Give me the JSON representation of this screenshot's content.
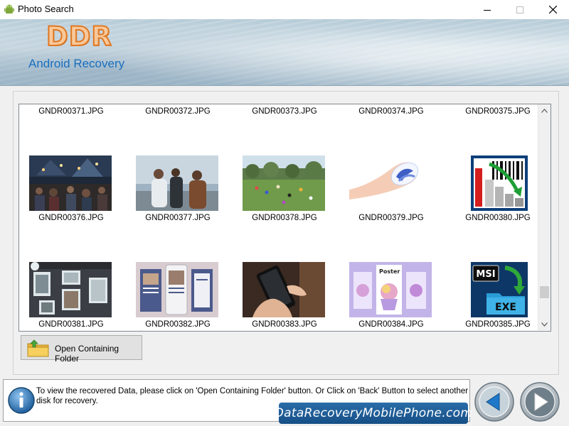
{
  "window": {
    "title": "Photo Search"
  },
  "banner": {
    "logo": "DDR",
    "product": "Android Recovery"
  },
  "grid": {
    "rows": [
      {
        "cells": [
          {
            "label": "GNDR00371.JPG",
            "kind": "none"
          },
          {
            "label": "GNDR00372.JPG",
            "kind": "none"
          },
          {
            "label": "GNDR00373.JPG",
            "kind": "none"
          },
          {
            "label": "GNDR00374.JPG",
            "kind": "none"
          },
          {
            "label": "GNDR00375.JPG",
            "kind": "none"
          }
        ]
      },
      {
        "cells": [
          {
            "label": "GNDR00376.JPG",
            "kind": "night-market"
          },
          {
            "label": "GNDR00377.JPG",
            "kind": "people-talking"
          },
          {
            "label": "GNDR00378.JPG",
            "kind": "park-lawn"
          },
          {
            "label": "GNDR00379.JPG",
            "kind": "nail-art"
          },
          {
            "label": "GNDR00380.JPG",
            "kind": "barcode-chart"
          }
        ]
      },
      {
        "cells": [
          {
            "label": "GNDR00381.JPG",
            "kind": "photo-collage"
          },
          {
            "label": "GNDR00382.JPG",
            "kind": "phone-mockups"
          },
          {
            "label": "GNDR00383.JPG",
            "kind": "hand-phone"
          },
          {
            "label": "GNDR00384.JPG",
            "kind": "poster-designs",
            "text": "Poster"
          },
          {
            "label": "GNDR00385.JPG",
            "kind": "msi-exe",
            "text_top": "MSI",
            "text_bottom": "EXE"
          }
        ]
      }
    ]
  },
  "buttons": {
    "open_folder": "Open Containing Folder"
  },
  "status": {
    "message": "To view the recovered Data, please click on 'Open Containing Folder' button. Or Click on 'Back' Button to select another disk for recovery.",
    "website": "DataRecoveryMobilePhone.com"
  },
  "colors": {
    "accent": "#1a6fbf",
    "logo_orange": "#e07822",
    "badge_blue": "#164f86"
  }
}
